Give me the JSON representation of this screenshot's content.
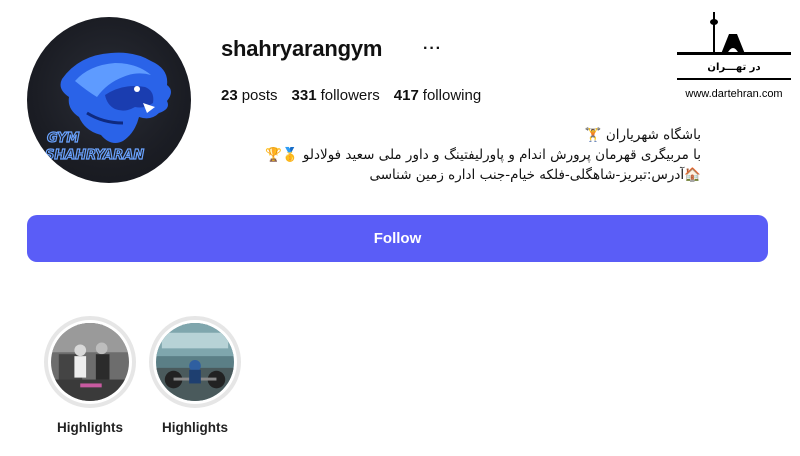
{
  "profile": {
    "username": "shahryarangym",
    "more_label": "···",
    "stats": {
      "posts_count": "23",
      "posts_label": "posts",
      "followers_count": "331",
      "followers_label": "followers",
      "following_count": "417",
      "following_label": "following"
    },
    "bio": {
      "line1": "باشگاه شهریاران 🏋",
      "line2": "با مربیگری قهرمان پرورش اندام و پاورلیفتینگ و داور ملی سعید فولادلو 🥇🏆",
      "line3": "🏠آدرس:تبریز-شاهگلی-فلکه خیام-جنب اداره زمین شناسی"
    },
    "avatar": {
      "icon": "lion-logo",
      "text_top": "GYM",
      "text_bottom": "SHAHRYARAN"
    }
  },
  "follow_button": {
    "label": "Follow",
    "color": "#5a5df7"
  },
  "highlights": [
    {
      "label": "Highlights"
    },
    {
      "label": "Highlights"
    }
  ],
  "watermark": {
    "logo_text": "در تهـــران",
    "url": "www.dartehran.com"
  }
}
